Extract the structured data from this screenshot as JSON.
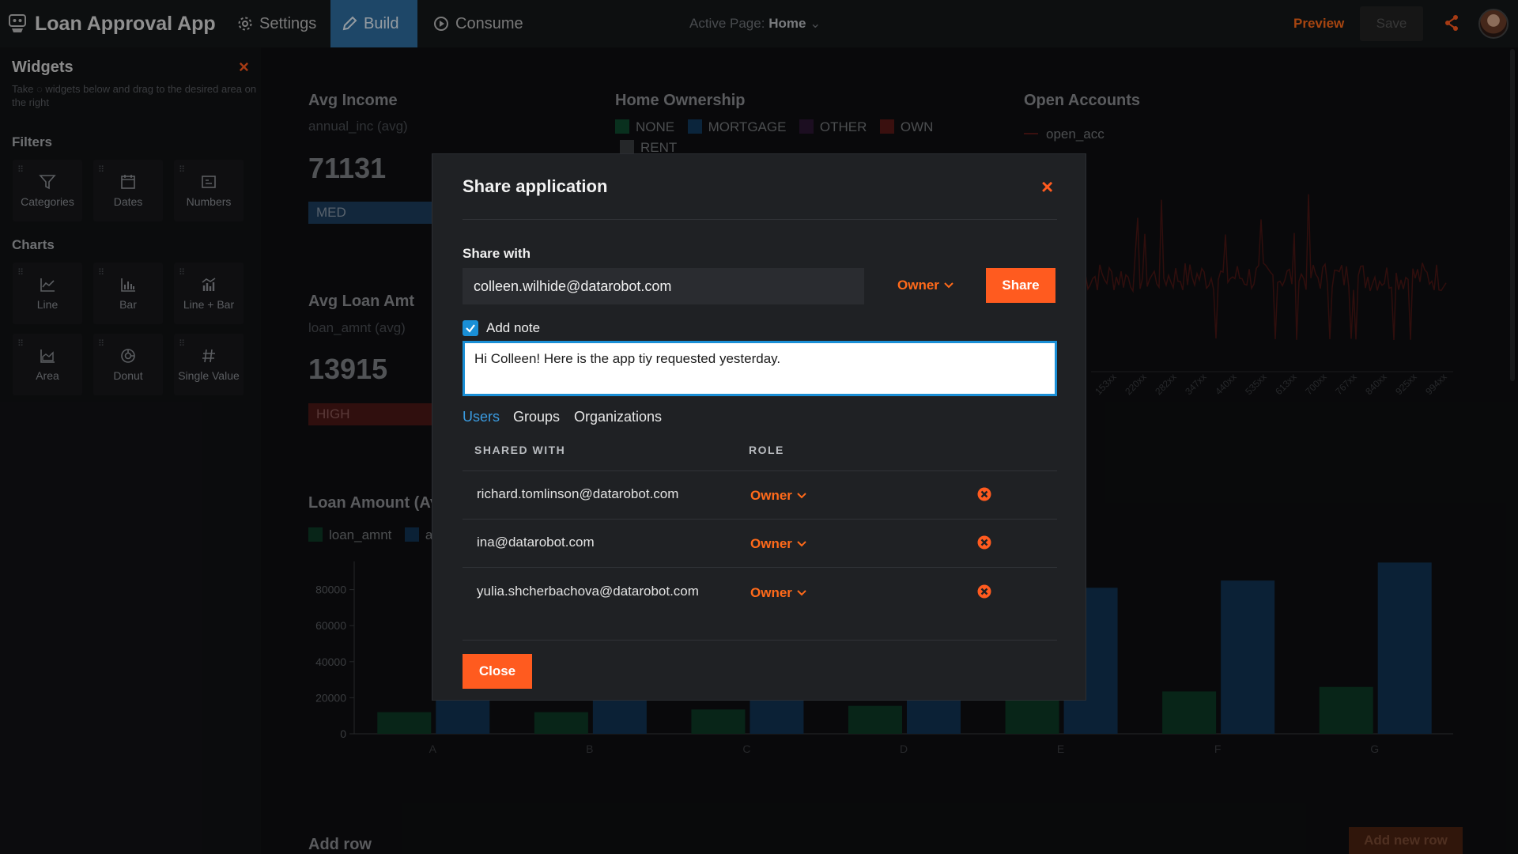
{
  "app": {
    "title": "Loan Approval App",
    "nav": [
      {
        "label": "Settings",
        "icon": "gear-icon"
      },
      {
        "label": "Build",
        "icon": "pencil-icon"
      },
      {
        "label": "Consume",
        "icon": "play-icon"
      }
    ],
    "active_page_label": "Active Page:",
    "active_page_value": "Home",
    "preview_label": "Preview",
    "save_label": "Save"
  },
  "widgets_panel": {
    "title": "Widgets",
    "hint": "Take ◌ widgets below and drag to the desired area on the right",
    "filters_title": "Filters",
    "filters": [
      {
        "label": "Categories",
        "icon": "filter-icon"
      },
      {
        "label": "Dates",
        "icon": "calendar-icon"
      },
      {
        "label": "Numbers",
        "icon": "numbers-icon"
      }
    ],
    "charts_title": "Charts",
    "charts": [
      {
        "label": "Line",
        "icon": "line-chart-icon"
      },
      {
        "label": "Bar",
        "icon": "bar-chart-icon"
      },
      {
        "label": "Line + Bar",
        "icon": "line-bar-chart-icon"
      },
      {
        "label": "Area",
        "icon": "area-chart-icon"
      },
      {
        "label": "Donut",
        "icon": "donut-chart-icon"
      },
      {
        "label": "Single Value",
        "icon": "hash-icon"
      }
    ]
  },
  "dashboard": {
    "avg_income": {
      "title": "Avg Income",
      "sub": "annual_inc (avg)",
      "value": "71131",
      "tag": "MED"
    },
    "avg_loan": {
      "title": "Avg Loan Amt",
      "sub": "loan_amnt (avg)",
      "value": "13915",
      "tag": "HIGH"
    },
    "home_ownership": {
      "title": "Home Ownership",
      "legend": [
        "NONE",
        "MORTGAGE",
        "OTHER",
        "OWN",
        "RENT"
      ]
    },
    "open_accounts": {
      "title": "Open Accounts",
      "legend": "open_acc",
      "xticks": [
        "153xx",
        "220xx",
        "282xx",
        "347xx",
        "440xx",
        "535xx",
        "613xx",
        "700xx",
        "767xx",
        "840xx",
        "925xx",
        "994xx"
      ]
    },
    "loan_amount": {
      "title": "Loan Amount (Av",
      "legend": [
        "loan_amnt",
        "a"
      ]
    },
    "add_row_label": "Add row",
    "add_new_row_label": "Add new row"
  },
  "modal": {
    "title": "Share application",
    "share_with_label": "Share with",
    "email_value": "colleen.wilhide@datarobot.com",
    "role_value": "Owner",
    "share_button": "Share",
    "add_note_label": "Add note",
    "add_note_checked": true,
    "note_value": "Hi Colleen! Here is the app tiy requested yesterday.",
    "tabs": [
      "Users",
      "Groups",
      "Organizations"
    ],
    "active_tab": "Users",
    "columns": [
      "SHARED WITH",
      "ROLE"
    ],
    "rows": [
      {
        "email": "richard.tomlinson@datarobot.com",
        "role": "Owner"
      },
      {
        "email": "ina@datarobot.com",
        "role": "Owner"
      },
      {
        "email": "yulia.shcherbachova@datarobot.com",
        "role": "Owner"
      }
    ],
    "close_button": "Close"
  },
  "chart_data": {
    "type": "bar",
    "title": "Loan Amount (Av",
    "categories": [
      "A",
      "B",
      "C",
      "D",
      "E",
      "F",
      "G"
    ],
    "ylim": [
      0,
      100000
    ],
    "yticks": [
      0,
      20000,
      40000,
      60000,
      80000
    ],
    "series": [
      {
        "name": "loan_amnt",
        "color": "#0d3a26",
        "values": [
          12000,
          12000,
          13500,
          15500,
          20000,
          23500,
          26000
        ]
      },
      {
        "name": "a",
        "color": "#113354",
        "values": [
          20000,
          20000,
          20000,
          20000,
          81000,
          85000,
          95000
        ]
      }
    ]
  },
  "colors": {
    "accent": "#ff5b1f",
    "link": "#3a9be0",
    "build_tab": "#2f6da0"
  }
}
